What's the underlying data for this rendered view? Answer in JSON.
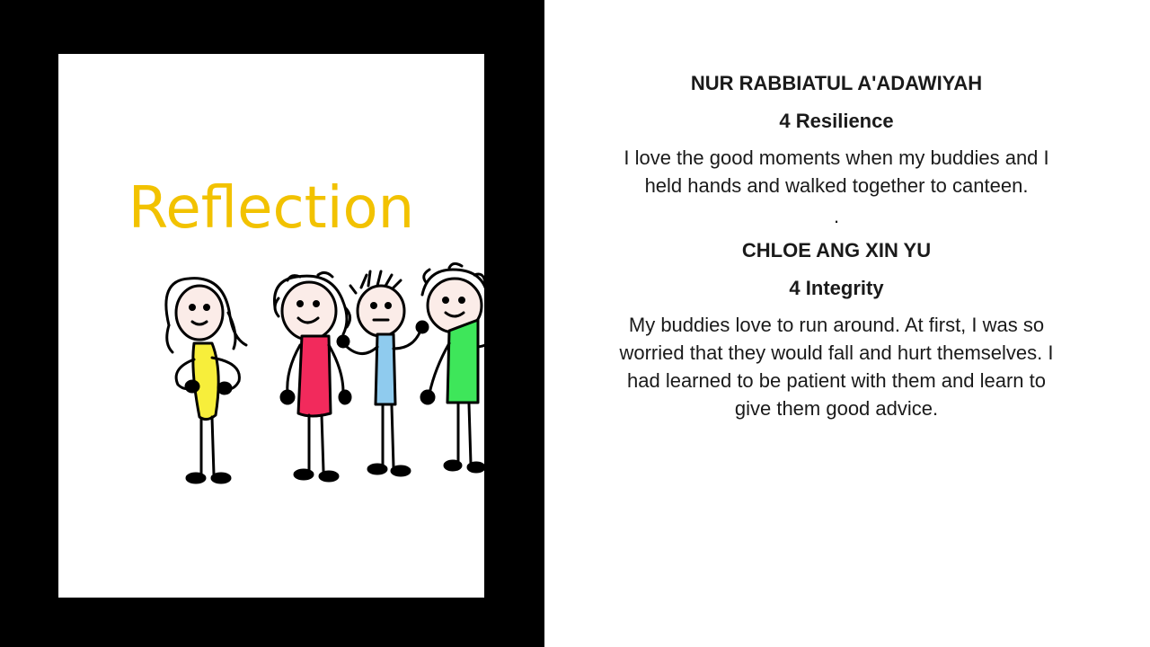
{
  "slide": {
    "card": {
      "title": "Reflection",
      "title_color": "#f2c200",
      "illustration": "four-stick-figure-children-drawing",
      "figure_colors": [
        "#f7ee3b",
        "#f22a5c",
        "#8fcbee",
        "#3ee65a"
      ]
    },
    "reflections": [
      {
        "name": "NUR RABBIATUL A'ADAWIYAH",
        "class_name": "4 Resilience",
        "text": "I love the good moments when my buddies and I held hands and walked together to canteen."
      },
      {
        "name": "CHLOE ANG XIN YU",
        "class_name": "4 Integrity",
        "text": "My buddies love to run around. At first, I was so worried that they would fall and hurt themselves. I had learned to be patient with them and learn to give them good advice."
      }
    ],
    "separator": "."
  }
}
